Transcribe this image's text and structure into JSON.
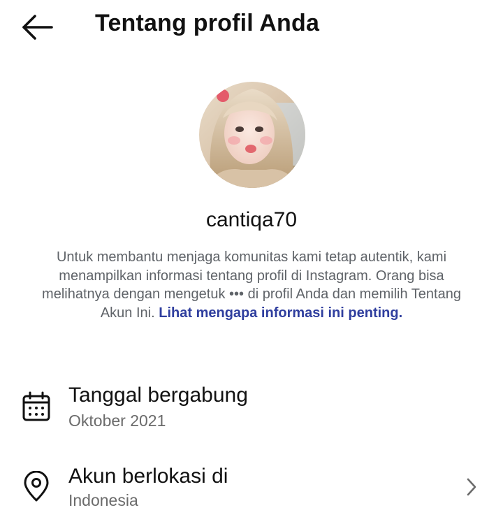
{
  "header": {
    "title": "Tentang profil Anda",
    "back_icon": "arrow-left-icon"
  },
  "profile": {
    "username": "cantiqa70",
    "avatar_alt": "profile-photo"
  },
  "description": {
    "text": "Untuk membantu menjaga komunitas kami tetap autentik, kami menampilkan informasi tentang profil di Instagram. Orang bisa melihatnya dengan mengetuk ••• di profil Anda dan memilih Tentang Akun Ini.",
    "link_text": "Lihat mengapa informasi ini penting."
  },
  "rows": [
    {
      "icon": "calendar-icon",
      "label": "Tanggal bergabung",
      "value": "Oktober 2021"
    },
    {
      "icon": "location-pin-icon",
      "label": "Akun berlokasi di",
      "value": "Indonesia",
      "chevron": "chevron-right-icon"
    }
  ],
  "colors": {
    "text_primary": "#111111",
    "text_secondary": "#5f6368",
    "link": "#2f3e9e"
  }
}
